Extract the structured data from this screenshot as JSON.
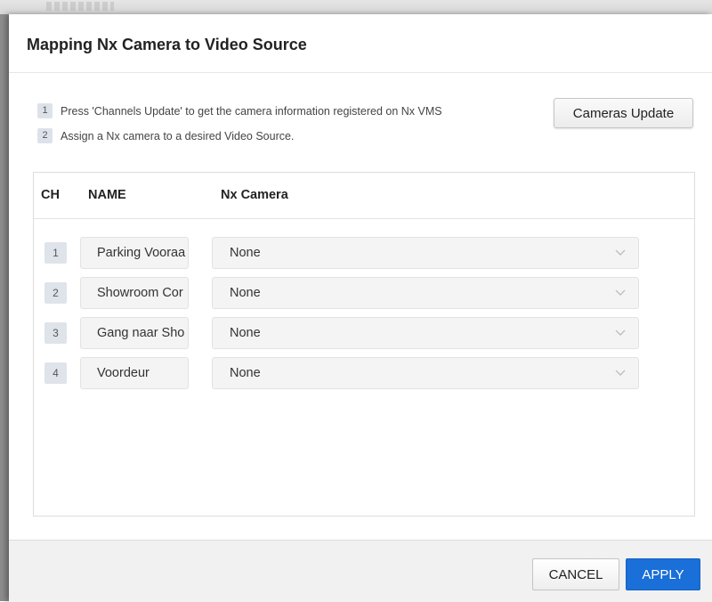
{
  "dialog": {
    "title": "Mapping Nx Camera to Video Source",
    "instructions": [
      {
        "num": "1",
        "text": "Press 'Channels Update' to get the camera information registered on Nx VMS"
      },
      {
        "num": "2",
        "text": "Assign a Nx camera to a desired Video Source."
      }
    ],
    "update_button": "Cameras Update"
  },
  "table": {
    "headers": {
      "ch": "CH",
      "name": "NAME",
      "camera": "Nx Camera"
    },
    "rows": [
      {
        "ch": "1",
        "name": "Parking Vooraa",
        "camera": "None"
      },
      {
        "ch": "2",
        "name": "Showroom Cor",
        "camera": "None"
      },
      {
        "ch": "3",
        "name": "Gang naar Sho",
        "camera": "None"
      },
      {
        "ch": "4",
        "name": "Voordeur",
        "camera": "None"
      }
    ]
  },
  "footer": {
    "cancel": "CANCEL",
    "apply": "APPLY"
  },
  "colors": {
    "primary": "#1a6fd8",
    "badge_bg": "#dfe4eb",
    "field_bg": "#f4f4f4"
  },
  "icons": {
    "select_chevron": "chevron-down-icon"
  }
}
